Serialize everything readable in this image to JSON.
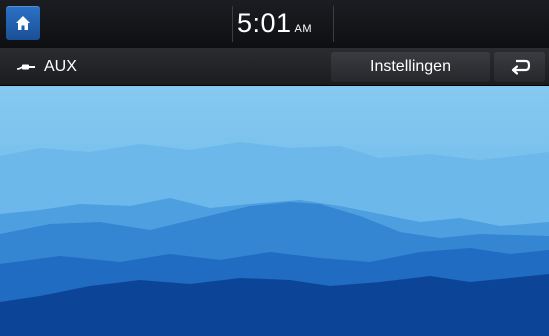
{
  "status_bar": {
    "time": "5:01",
    "ampm": "AM"
  },
  "source_bar": {
    "source_label": "AUX",
    "settings_label": "Instellingen"
  },
  "icons": {
    "home": "home-icon",
    "aux": "aux-cable-icon",
    "back": "back-arrow-icon"
  },
  "colors": {
    "home_button": "#1f5ca8",
    "sky_top": "#7fc4ef",
    "mountain_dark": "#0a3f8c"
  }
}
